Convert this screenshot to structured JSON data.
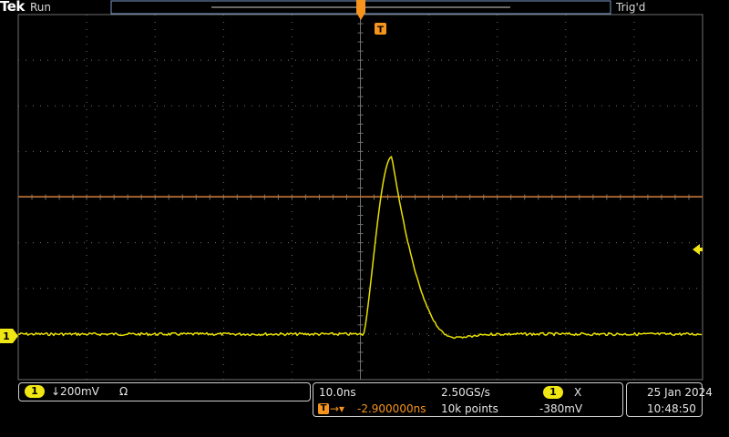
{
  "header": {
    "brand": "Tek",
    "acquisition_state": "Run",
    "trigger_status": "Trig'd"
  },
  "trigger_marker": {
    "label": "T"
  },
  "channel1": {
    "badge": "1",
    "scale": "↓200mV",
    "termination_symbol": "Ω",
    "ground_marker": "1",
    "color": "#f0e614",
    "trace_color": "#e8e000"
  },
  "timebase": {
    "scale": "10.0ns",
    "sample_rate": "2.50GS/s",
    "trigger_badge": "T",
    "trigger_arrows": "→▾",
    "delay": "-2.900000ns",
    "record_length": "10k points"
  },
  "trigger": {
    "source_badge": "1",
    "slope_symbol": "X",
    "level": "-380mV",
    "level_line_color": "#e07a28"
  },
  "datetime": {
    "date": "25 Jan  2024",
    "time": "10:48:50"
  },
  "colors": {
    "grid": "#707070",
    "accent_orange": "#f7941d",
    "trigger_level_arrow": "#f0e614"
  }
}
